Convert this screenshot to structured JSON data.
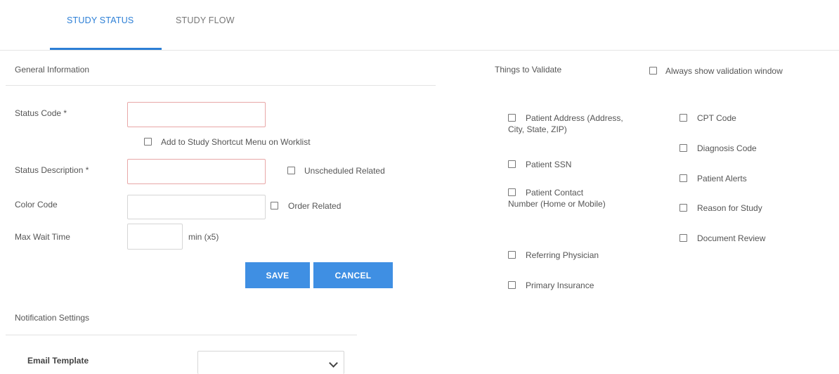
{
  "tabs": [
    {
      "label": "STUDY STATUS",
      "active": true
    },
    {
      "label": "STUDY FLOW",
      "active": false
    }
  ],
  "general": {
    "heading": "General Information",
    "status_code_label": "Status Code *",
    "status_code_value": "",
    "add_shortcut_label": "Add to Study Shortcut Menu on Worklist",
    "status_desc_label": "Status Description *",
    "status_desc_value": "",
    "unscheduled_label": "Unscheduled Related",
    "color_code_label": "Color Code",
    "color_code_value": "",
    "order_related_label": "Order Related",
    "max_wait_label": "Max Wait Time",
    "max_wait_value": "",
    "max_wait_unit": "min (x5)",
    "save_label": "SAVE",
    "cancel_label": "CANCEL"
  },
  "validate": {
    "heading": "Things to Validate",
    "always_show_label": "Always show validation window",
    "col1": [
      "Patient Address (Address, City, State, ZIP)",
      "Patient SSN",
      "Patient Contact Number (Home or Mobile)",
      "Referring Physician",
      "Primary Insurance"
    ],
    "col2": [
      "CPT Code",
      "Diagnosis Code",
      "Patient Alerts",
      "Reason for Study",
      "Document Review"
    ]
  },
  "notification": {
    "heading": "Notification Settings",
    "email_template_label": "Email Template",
    "email_template_value": ""
  },
  "colors": {
    "accent": "#2c7fd6",
    "button": "#3f8fe3",
    "required_border": "#e8a7a7"
  }
}
